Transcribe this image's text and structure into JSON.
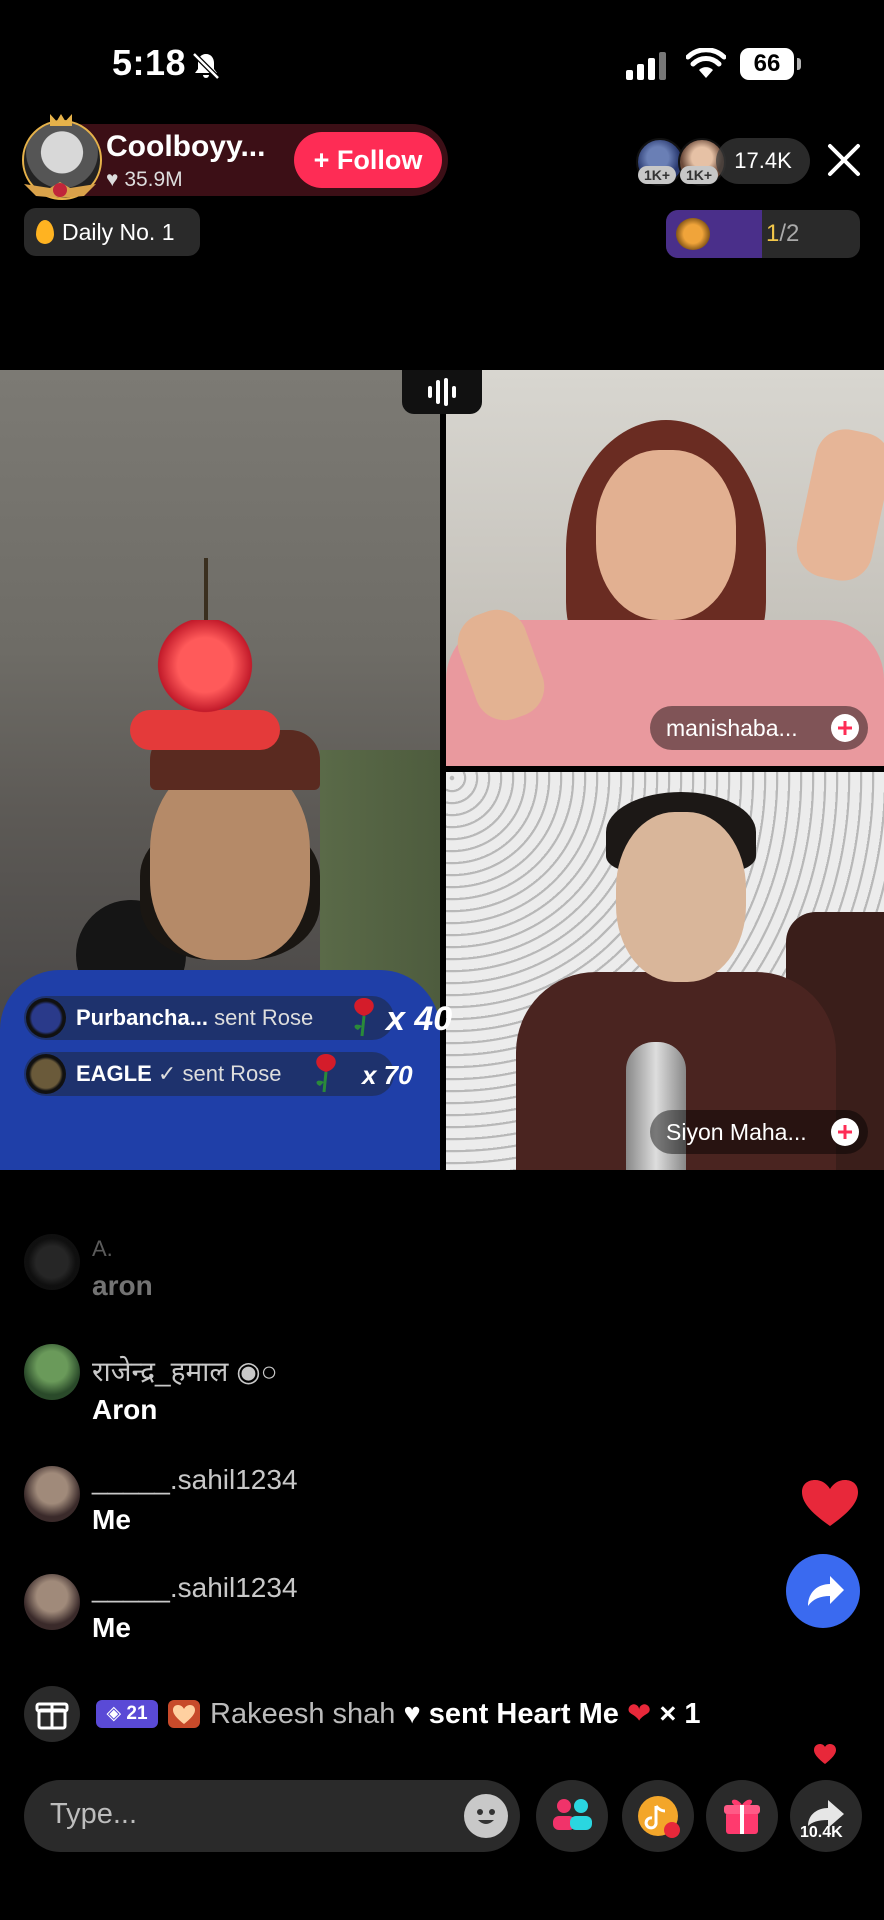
{
  "status_bar": {
    "time": "5:18",
    "battery": "66"
  },
  "host": {
    "name": "Coolboyy...",
    "likes": "35.9M",
    "follow_label": "+ Follow"
  },
  "viewers": {
    "badge1": "1K+",
    "badge2": "1K+",
    "count": "17.4K"
  },
  "daily_badge": "Daily No. 1",
  "match": {
    "current": "1",
    "total": "/2"
  },
  "panels": [
    {
      "name": "manishaba..."
    },
    {
      "name": "Siyon Maha..."
    }
  ],
  "gift_toasts": [
    {
      "user": "Purbancha...",
      "action": "sent Rose",
      "multiplier": "x 40"
    },
    {
      "user": "EAGLE",
      "action": "sent Rose",
      "multiplier": "x 70"
    }
  ],
  "comments": [
    {
      "user": "A.",
      "message": "aron"
    },
    {
      "user": "राजेन्द्र_हमाल",
      "message": "Aron"
    },
    {
      "user": "_____.sahil1234",
      "message": "Me"
    },
    {
      "user": "_____.sahil1234",
      "message": "Me"
    }
  ],
  "gift_line": {
    "level": "21",
    "user": "Rakeesh shah",
    "action": "sent Heart Me",
    "count": "× 1"
  },
  "bottom_bar": {
    "placeholder": "Type...",
    "share_count": "10.4K"
  },
  "colors": {
    "follow": "#fe2c55",
    "share": "#3a6af0",
    "heart": "#e8283a"
  }
}
